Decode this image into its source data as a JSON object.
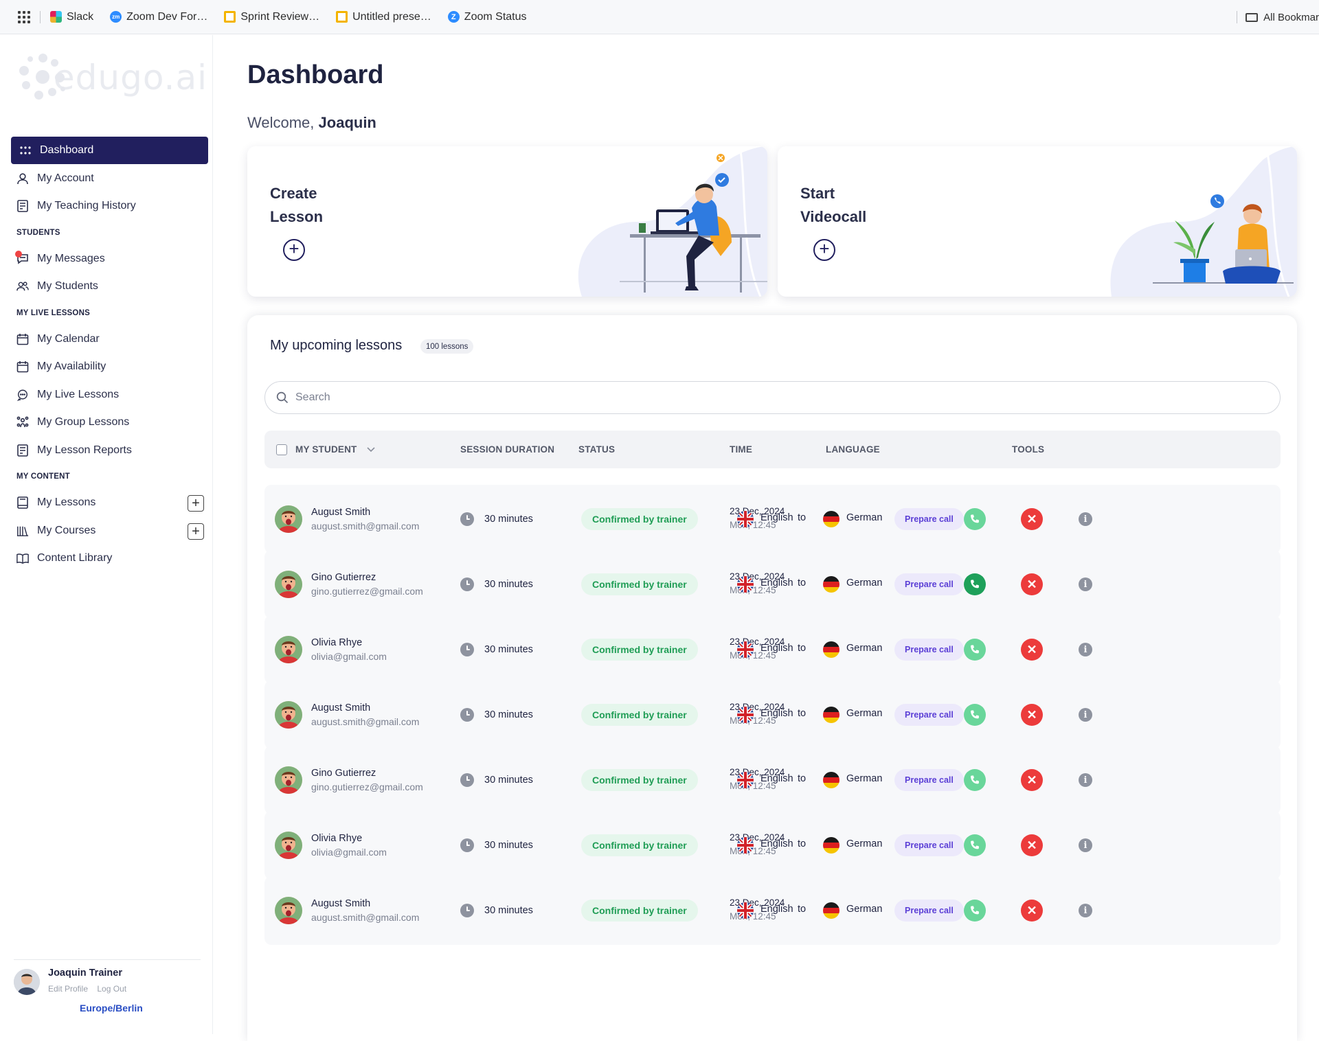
{
  "bookmarks": {
    "items": [
      {
        "label": "Slack",
        "icon": "slack-icon"
      },
      {
        "label": "Zoom Dev For…",
        "icon": "zoom-icon"
      },
      {
        "label": "Sprint Review…",
        "icon": "slides-icon"
      },
      {
        "label": "Untitled prese…",
        "icon": "slides-icon"
      },
      {
        "label": "Zoom Status",
        "icon": "zoom-status-icon"
      }
    ],
    "all_bookmarks": "All Bookmar"
  },
  "brand": {
    "logo_text": "edugo.ai"
  },
  "sidebar": {
    "dashboard": "Dashboard",
    "my_account": "My Account",
    "my_teaching_history": "My Teaching History",
    "section_students": "STUDENTS",
    "my_messages": "My Messages",
    "my_students": "My Students",
    "section_live": "MY LIVE LESSONS",
    "my_calendar": "My Calendar",
    "my_availability": "My Availability",
    "my_live_lessons": "My Live Lessons",
    "my_group_lessons": "My Group Lessons",
    "my_lesson_reports": "My Lesson Reports",
    "section_content": "MY CONTENT",
    "my_lessons": "My Lessons",
    "my_courses": "My Courses",
    "content_library": "Content Library"
  },
  "profile": {
    "name": "Joaquin Trainer",
    "edit_profile": "Edit Profile",
    "log_out": "Log Out",
    "timezone": "Europe/Berlin"
  },
  "main": {
    "title": "Dashboard",
    "welcome_prefix": "Welcome,",
    "welcome_name": "Joaquin",
    "card_create_line1": "Create",
    "card_create_line2": "Lesson",
    "card_video_line1": "Start",
    "card_video_line2": "Videocall"
  },
  "lessons": {
    "title": "My upcoming lessons",
    "count": "100 lessons",
    "search_placeholder": "Search",
    "columns": {
      "student": "MY STUDENT",
      "duration": "SESSION DURATION",
      "status": "STATUS",
      "time": "TIME",
      "language": "LANGUAGE",
      "tools": "TOOLS"
    },
    "rows": [
      {
        "name": "August Smith",
        "email": "august.smith@gmail.com",
        "duration": "30 minutes",
        "status": "Confirmed by trainer",
        "date": "23 Dec, 2024",
        "day": "Mon, 12:45",
        "from": "English",
        "to": "to",
        "target": "German",
        "prepare": "Prepare call",
        "call_active": false
      },
      {
        "name": "Gino Gutierrez",
        "email": "gino.gutierrez@gmail.com",
        "duration": "30 minutes",
        "status": "Confirmed by trainer",
        "date": "23 Dec, 2024",
        "day": "Mon, 12:45",
        "from": "English",
        "to": "to",
        "target": "German",
        "prepare": "Prepare call",
        "call_active": true
      },
      {
        "name": "Olivia Rhye",
        "email": "olivia@gmail.com",
        "duration": "30 minutes",
        "status": "Confirmed by trainer",
        "date": "23 Dec, 2024",
        "day": "Mon, 12:45",
        "from": "English",
        "to": "to",
        "target": "German",
        "prepare": "Prepare call",
        "call_active": false
      },
      {
        "name": "August Smith",
        "email": "august.smith@gmail.com",
        "duration": "30 minutes",
        "status": "Confirmed by trainer",
        "date": "23 Dec, 2024",
        "day": "Mon, 12:45",
        "from": "English",
        "to": "to",
        "target": "German",
        "prepare": "Prepare call",
        "call_active": false
      },
      {
        "name": "Gino Gutierrez",
        "email": "gino.gutierrez@gmail.com",
        "duration": "30 minutes",
        "status": "Confirmed by trainer",
        "date": "23 Dec, 2024",
        "day": "Mon, 12:45",
        "from": "English",
        "to": "to",
        "target": "German",
        "prepare": "Prepare call",
        "call_active": false
      },
      {
        "name": "Olivia Rhye",
        "email": "olivia@gmail.com",
        "duration": "30 minutes",
        "status": "Confirmed by trainer",
        "date": "23 Dec, 2024",
        "day": "Mon, 12:45",
        "from": "English",
        "to": "to",
        "target": "German",
        "prepare": "Prepare call",
        "call_active": false
      },
      {
        "name": "August Smith",
        "email": "august.smith@gmail.com",
        "duration": "30 minutes",
        "status": "Confirmed by trainer",
        "date": "23 Dec, 2024",
        "day": "Mon, 12:45",
        "from": "English",
        "to": "to",
        "target": "German",
        "prepare": "Prepare call",
        "call_active": false
      }
    ]
  },
  "colors": {
    "primary": "#211f5e",
    "status_green": "#1f9d55",
    "call_green": "#69d69a",
    "cancel_red": "#ec3b3b",
    "prepare_purple": "#5b3fd6"
  }
}
